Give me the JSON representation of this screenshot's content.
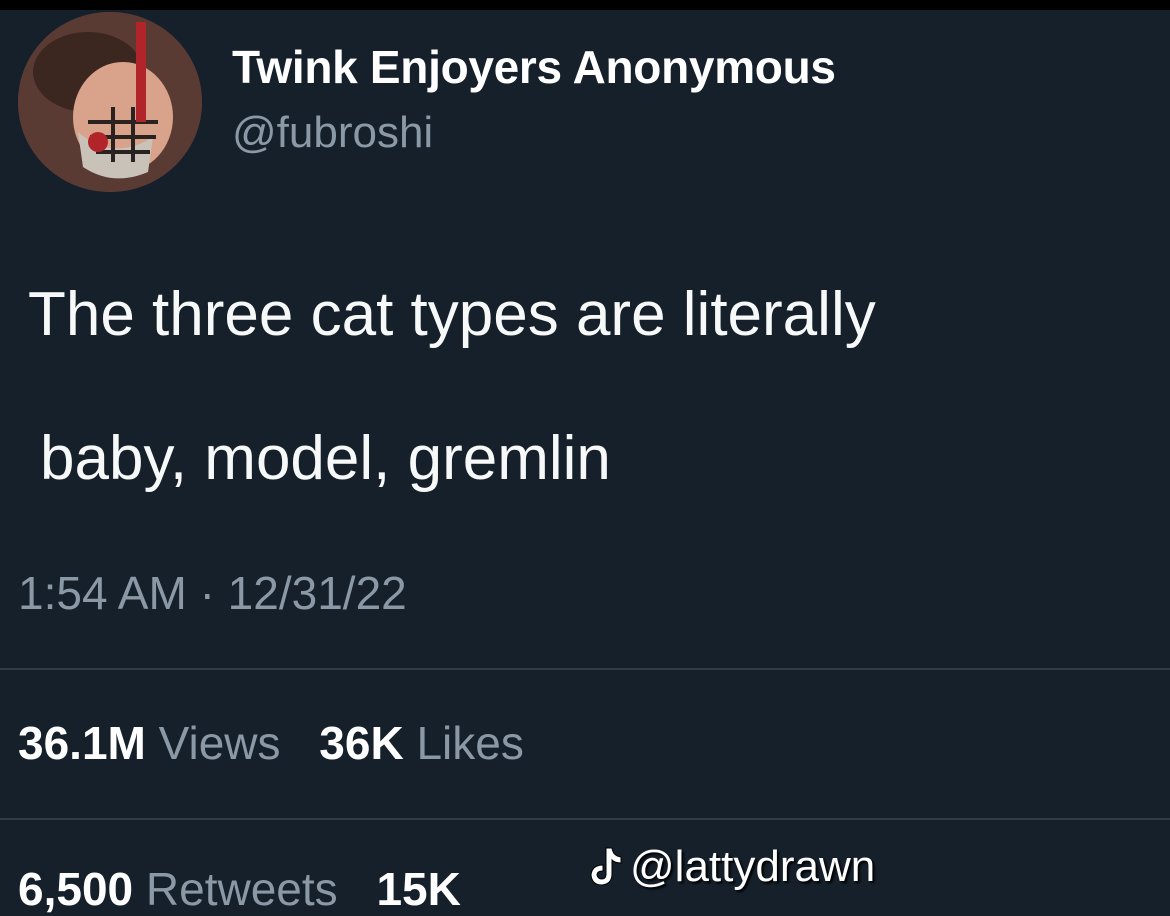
{
  "tweet": {
    "author": {
      "display_name": "Twink Enjoyers Anonymous",
      "handle": "@fubroshi"
    },
    "text_line_1": "The three cat types are literally",
    "text_line_2": "baby, model, gremlin",
    "time": "1:54 AM",
    "separator": "·",
    "date": "12/31/22",
    "stats": {
      "views_count": "36.1M",
      "views_label": "Views",
      "likes_count": "36K",
      "likes_label": "Likes",
      "retweets_count": "6,500",
      "retweets_label": "Retweets",
      "quotes_count": "15K"
    }
  },
  "watermark": {
    "icon": "tiktok-icon",
    "text": "@lattydrawn"
  },
  "colors": {
    "background": "#15202b",
    "primary_text": "#ffffff",
    "secondary_text": "#8b98a5",
    "divider": "#2f3b47"
  }
}
